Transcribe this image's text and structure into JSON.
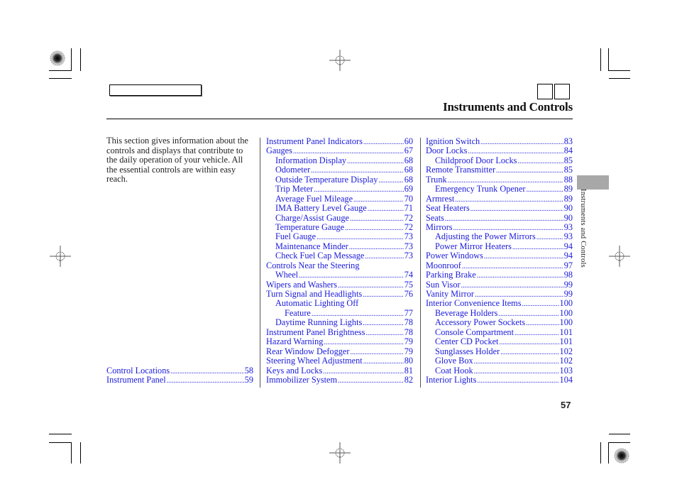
{
  "header": {
    "section_title": "Instruments and Controls"
  },
  "intro_text": "This section gives information about the controls and displays that contribute to the daily operation of your vehicle. All the essential controls are within easy reach.",
  "side_tab": {
    "label": "Instruments and Controls"
  },
  "page_number": "57",
  "toc": {
    "column1": [
      {
        "label": "Control Locations",
        "page": "58",
        "indent": 0
      },
      {
        "label": "Instrument Panel",
        "page": "59",
        "indent": 0
      }
    ],
    "column2": [
      {
        "label": "Instrument Panel Indicators",
        "page": "60",
        "indent": 0
      },
      {
        "label": "Gauges",
        "page": "67",
        "indent": 0
      },
      {
        "label": "Information Display",
        "page": "68",
        "indent": 1
      },
      {
        "label": "Odometer",
        "page": "68",
        "indent": 1
      },
      {
        "label": "Outside Temperature Display",
        "page": "68",
        "indent": 1
      },
      {
        "label": "Trip Meter",
        "page": "69",
        "indent": 1
      },
      {
        "label": "Average Fuel Mileage",
        "page": "70",
        "indent": 1
      },
      {
        "label": "IMA Battery Level Gauge",
        "page": "71",
        "indent": 1
      },
      {
        "label": "Charge/Assist Gauge",
        "page": "72",
        "indent": 1
      },
      {
        "label": "Temperature Gauge",
        "page": "72",
        "indent": 1
      },
      {
        "label": "Fuel Gauge",
        "page": "73",
        "indent": 1
      },
      {
        "label": "Maintenance Minder",
        "page": "73",
        "indent": 1
      },
      {
        "label": "Check Fuel Cap Message",
        "page": "73",
        "indent": 1
      },
      {
        "label": "Controls Near the Steering",
        "page": "",
        "indent": 0
      },
      {
        "label": "Wheel",
        "page": "74",
        "indent": 1
      },
      {
        "label": "Wipers and Washers",
        "page": "75",
        "indent": 0
      },
      {
        "label": "Turn Signal and Headlights",
        "page": "76",
        "indent": 0
      },
      {
        "label": "Automatic Lighting Off",
        "page": "",
        "indent": 1
      },
      {
        "label": "Feature",
        "page": "77",
        "indent": 2
      },
      {
        "label": "Daytime Running Lights",
        "page": "78",
        "indent": 1
      },
      {
        "label": "Instrument Panel Brightness",
        "page": "78",
        "indent": 0
      },
      {
        "label": "Hazard Warning",
        "page": "79",
        "indent": 0
      },
      {
        "label": "Rear Window Defogger",
        "page": "79",
        "indent": 0
      },
      {
        "label": "Steering Wheel Adjustment",
        "page": "80",
        "indent": 0
      },
      {
        "label": "Keys and Locks",
        "page": "81",
        "indent": 0
      },
      {
        "label": "Immobilizer System",
        "page": "82",
        "indent": 0
      }
    ],
    "column3": [
      {
        "label": "Ignition Switch",
        "page": "83",
        "indent": 0
      },
      {
        "label": "Door Locks",
        "page": "84",
        "indent": 0
      },
      {
        "label": "Childproof Door Locks",
        "page": "85",
        "indent": 1
      },
      {
        "label": "Remote Transmitter",
        "page": "85",
        "indent": 0
      },
      {
        "label": "Trunk",
        "page": "88",
        "indent": 0
      },
      {
        "label": "Emergency Trunk Opener",
        "page": "89",
        "indent": 1
      },
      {
        "label": "Armrest",
        "page": "89",
        "indent": 0
      },
      {
        "label": "Seat Heaters",
        "page": "90",
        "indent": 0
      },
      {
        "label": "Seats",
        "page": "90",
        "indent": 0
      },
      {
        "label": "Mirrors",
        "page": "93",
        "indent": 0
      },
      {
        "label": "Adjusting the Power Mirrors",
        "page": "93",
        "indent": 1
      },
      {
        "label": "Power Mirror Heaters",
        "page": "94",
        "indent": 1
      },
      {
        "label": "Power Windows",
        "page": "94",
        "indent": 0
      },
      {
        "label": "Moonroof",
        "page": "97",
        "indent": 0
      },
      {
        "label": "Parking Brake",
        "page": "98",
        "indent": 0
      },
      {
        "label": "Sun Visor",
        "page": "99",
        "indent": 0
      },
      {
        "label": "Vanity Mirror",
        "page": "99",
        "indent": 0
      },
      {
        "label": "Interior Convenience Items",
        "page": "100",
        "indent": 0
      },
      {
        "label": "Beverage Holders",
        "page": "100",
        "indent": 1
      },
      {
        "label": "Accessory Power Sockets",
        "page": "100",
        "indent": 1
      },
      {
        "label": "Console Compartment",
        "page": "101",
        "indent": 1
      },
      {
        "label": "Center CD Pocket",
        "page": "101",
        "indent": 1
      },
      {
        "label": "Sunglasses Holder",
        "page": "102",
        "indent": 1
      },
      {
        "label": "Glove Box",
        "page": "102",
        "indent": 1
      },
      {
        "label": "Coat Hook",
        "page": "103",
        "indent": 1
      },
      {
        "label": "Interior Lights",
        "page": "104",
        "indent": 0
      }
    ]
  }
}
